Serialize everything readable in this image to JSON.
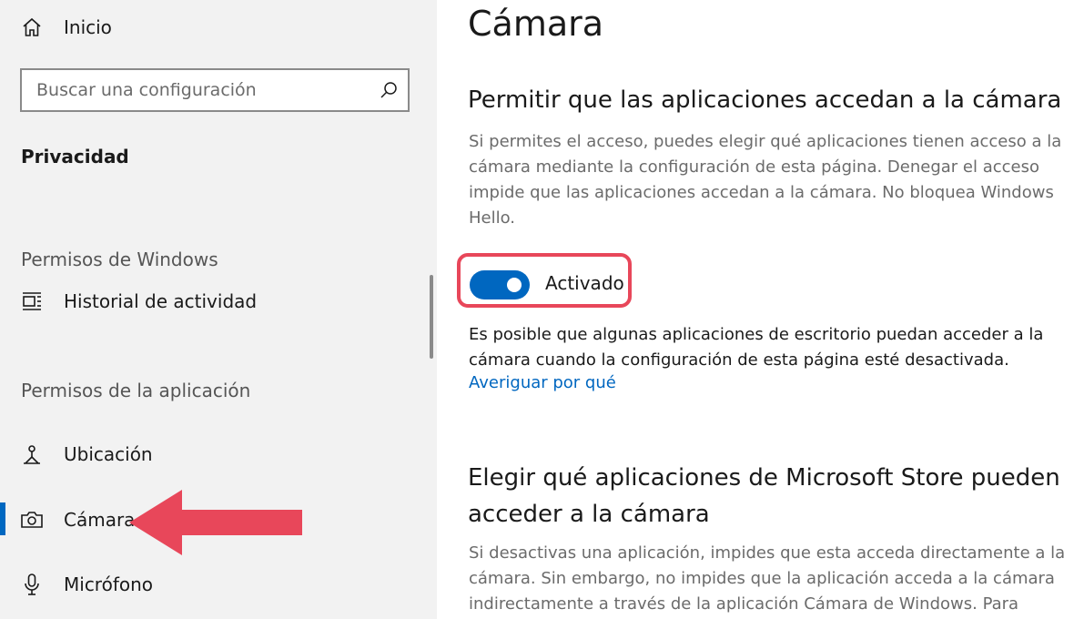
{
  "sidebar": {
    "home_label": "Inicio",
    "search_placeholder": "Buscar una configuración",
    "section_title": "Privacidad",
    "windows_permissions_label": "Permisos de Windows",
    "activity_history_label": "Historial de actividad",
    "app_permissions_label": "Permisos de la aplicación",
    "location_label": "Ubicación",
    "camera_label": "Cámara",
    "microphone_label": "Micrófono"
  },
  "main": {
    "title": "Cámara",
    "allow_heading": "Permitir que las aplicaciones accedan a la cámara",
    "allow_description": "Si permites el acceso, puedes elegir qué aplicaciones tienen acceso a la cámara mediante la configuración de esta página. Denegar el acceso impide que las aplicaciones accedan a la cámara. No bloquea Windows Hello.",
    "toggle_state": "Activado",
    "desktop_note": "Es posible que algunas aplicaciones de escritorio puedan acceder a la cámara cuando la configuración de esta página esté desactivada.",
    "learn_why_link": "Averiguar por qué",
    "store_heading": "Elegir qué aplicaciones de Microsoft Store pueden acceder a la cámara",
    "store_description": "Si desactivas una aplicación, impides que esta acceda directamente a la cámara. Sin embargo, no impides que la aplicación acceda a la cámara indirectamente a través de la aplicación Cámara de Windows. Para"
  },
  "colors": {
    "accent": "#0067c0",
    "highlight": "#e8475a",
    "sidebar_bg": "#f2f2f2"
  }
}
